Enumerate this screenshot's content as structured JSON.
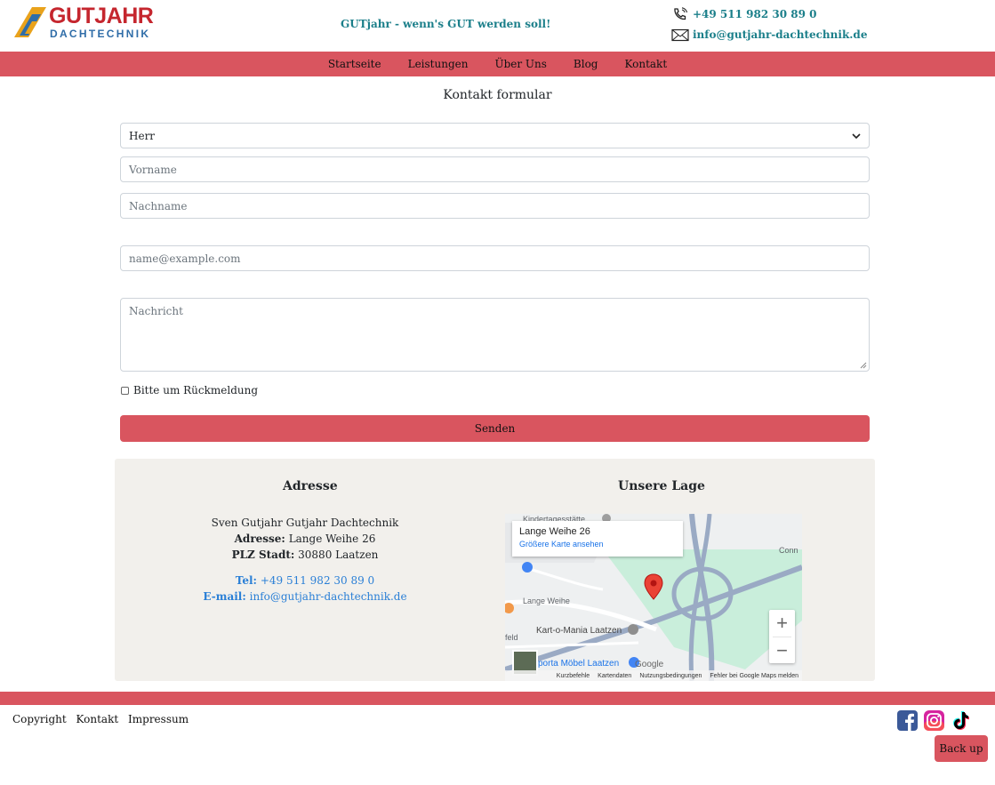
{
  "brand": {
    "name": "GUTJAHR",
    "sub": "DACHTECHNIK"
  },
  "header": {
    "tagline": "GUTjahr - wenn's GUT werden soll!",
    "phone": "+49 511 982 30 89 0",
    "email": "info@gutjahr-dachtechnik.de"
  },
  "nav": {
    "items": [
      "Startseite",
      "Leistungen",
      "Über Uns",
      "Blog",
      "Kontakt"
    ]
  },
  "form": {
    "title": "Kontakt formular",
    "salutation": "Herr",
    "firstname_placeholder": "Vorname",
    "lastname_placeholder": "Nachname",
    "email_placeholder": "name@example.com",
    "message_placeholder": "Nachricht",
    "callback_label": "Bitte um Rückmeldung",
    "submit": "Senden"
  },
  "address": {
    "heading": "Adresse",
    "company": "Sven Gutjahr Gutjahr Dachtechnik",
    "street_label": "Adresse:",
    "street": "Lange Weihe 26",
    "city_label": "PLZ Stadt:",
    "city": "30880 Laatzen",
    "tel_label": "Tel:",
    "tel": "+49 511 982 30 89 0",
    "mail_label": "E-mail:",
    "mail": "info@gutjahr-dachtechnik.de"
  },
  "map": {
    "heading": "Unsere Lage",
    "place": "Lange Weihe 26",
    "larger_map": "Größere Karte ansehen",
    "labels": {
      "kita": "Kindertagesstätte",
      "street": "Lange Weihe",
      "kart": "Kart-o-Mania Laatzen",
      "porta": "porta Möbel Laatzen",
      "conn": "Conn",
      "feld": "feld"
    },
    "google": "Google",
    "footer": [
      "Kurzbefehle",
      "Kartendaten",
      "Nutzungsbedingungen",
      "Fehler bei Google Maps melden"
    ]
  },
  "footer": {
    "links": [
      "Copyright",
      "Kontakt",
      "Impressum"
    ],
    "back_up": "Back up"
  },
  "colors": {
    "accent": "#d9555f",
    "teal": "#1b7f8a",
    "link_blue": "#2a7fd6",
    "info_bg": "#f2f0ec"
  }
}
